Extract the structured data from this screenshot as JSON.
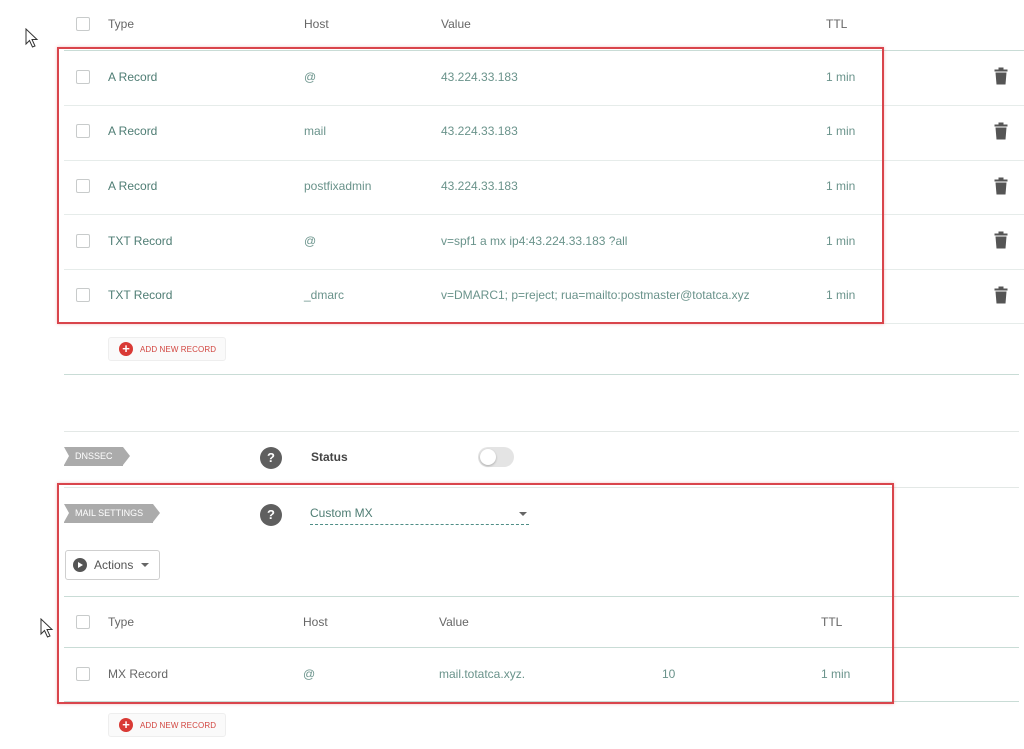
{
  "top_table": {
    "headers": {
      "type": "Type",
      "host": "Host",
      "value": "Value",
      "ttl": "TTL"
    },
    "rows": [
      {
        "type": "A Record",
        "host": "@",
        "value": "43.224.33.183",
        "ttl": "1 min"
      },
      {
        "type": "A Record",
        "host": "mail",
        "value": "43.224.33.183",
        "ttl": "1 min"
      },
      {
        "type": "A Record",
        "host": "postfixadmin",
        "value": "43.224.33.183",
        "ttl": "1 min"
      },
      {
        "type": "TXT Record",
        "host": "@",
        "value": "v=spf1 a mx ip4:43.224.33.183 ?all",
        "ttl": "1 min"
      },
      {
        "type": "TXT Record",
        "host": "_dmarc",
        "value": "v=DMARC1; p=reject; rua=mailto:postmaster@totatca.xyz",
        "ttl": "1 min"
      }
    ],
    "add_label": "ADD NEW RECORD"
  },
  "dnssec": {
    "tag": "DNSSEC",
    "help": "?",
    "status_label": "Status",
    "enabled": false
  },
  "mail_settings": {
    "tag": "MAIL SETTINGS",
    "help": "?",
    "mode": "Custom MX",
    "actions_label": "Actions",
    "headers": {
      "type": "Type",
      "host": "Host",
      "value": "Value",
      "ttl": "TTL"
    },
    "rows": [
      {
        "type": "MX Record",
        "host": "@",
        "value": "mail.totatca.xyz.",
        "priority": "10",
        "ttl": "1 min"
      }
    ],
    "add_label": "ADD NEW RECORD"
  },
  "colors": {
    "accent": "#4f7d74",
    "highlight": "#d9454c",
    "danger": "#d93a35"
  },
  "icons": [
    "cursor-arrow-icon",
    "trash-icon",
    "plus-circle-icon",
    "help-icon",
    "play-circle-icon",
    "caret-down-icon"
  ]
}
